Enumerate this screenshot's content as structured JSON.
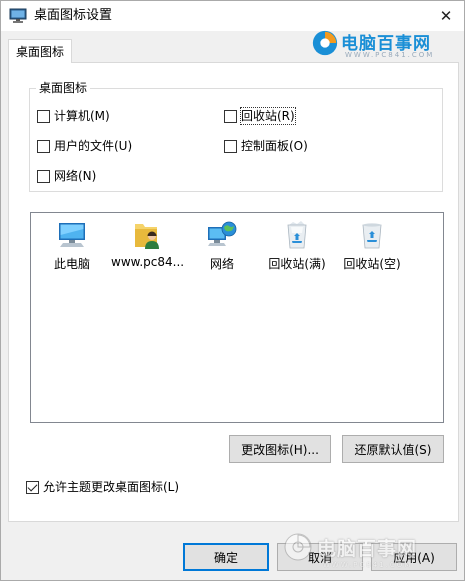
{
  "window": {
    "title": "桌面图标设置",
    "title_icon": "desktop-settings-icon",
    "close_glyph": "✕"
  },
  "branding": {
    "logo_text": "电脑百事网",
    "logo_url": "WWW.PC841.COM",
    "logo_icon": "pc841-logo-icon",
    "watermark_text": "电脑百事网",
    "watermark_url": "WWW.PC841.COM"
  },
  "tab": {
    "label": "桌面图标"
  },
  "group": {
    "title": "桌面图标",
    "checkboxes": [
      {
        "label": "计算机(M)",
        "checked": false
      },
      {
        "label": "回收站(R)",
        "checked": false
      },
      {
        "label": "用户的文件(U)",
        "checked": false
      },
      {
        "label": "控制面板(O)",
        "checked": false
      },
      {
        "label": "网络(N)",
        "checked": false
      }
    ]
  },
  "icons": [
    {
      "label": "此电脑",
      "icon": "this-pc-icon"
    },
    {
      "label": "www.pc84...",
      "icon": "user-folder-icon"
    },
    {
      "label": "网络",
      "icon": "network-icon"
    },
    {
      "label": "回收站(满)",
      "icon": "recycle-bin-full-icon"
    },
    {
      "label": "回收站(空)",
      "icon": "recycle-bin-empty-icon"
    }
  ],
  "buttons": {
    "change_icon": "更改图标(H)...",
    "restore_default": "还原默认值(S)",
    "ok": "确定",
    "cancel": "取消",
    "apply": "应用(A)"
  },
  "allow_themes": {
    "label": "允许主题更改桌面图标(L)",
    "checked": true
  },
  "colors": {
    "accent": "#0078d7",
    "brand_blue": "#1a8fd6",
    "brand_orange": "#f39a1e",
    "window_bg": "#f0f0f0"
  }
}
